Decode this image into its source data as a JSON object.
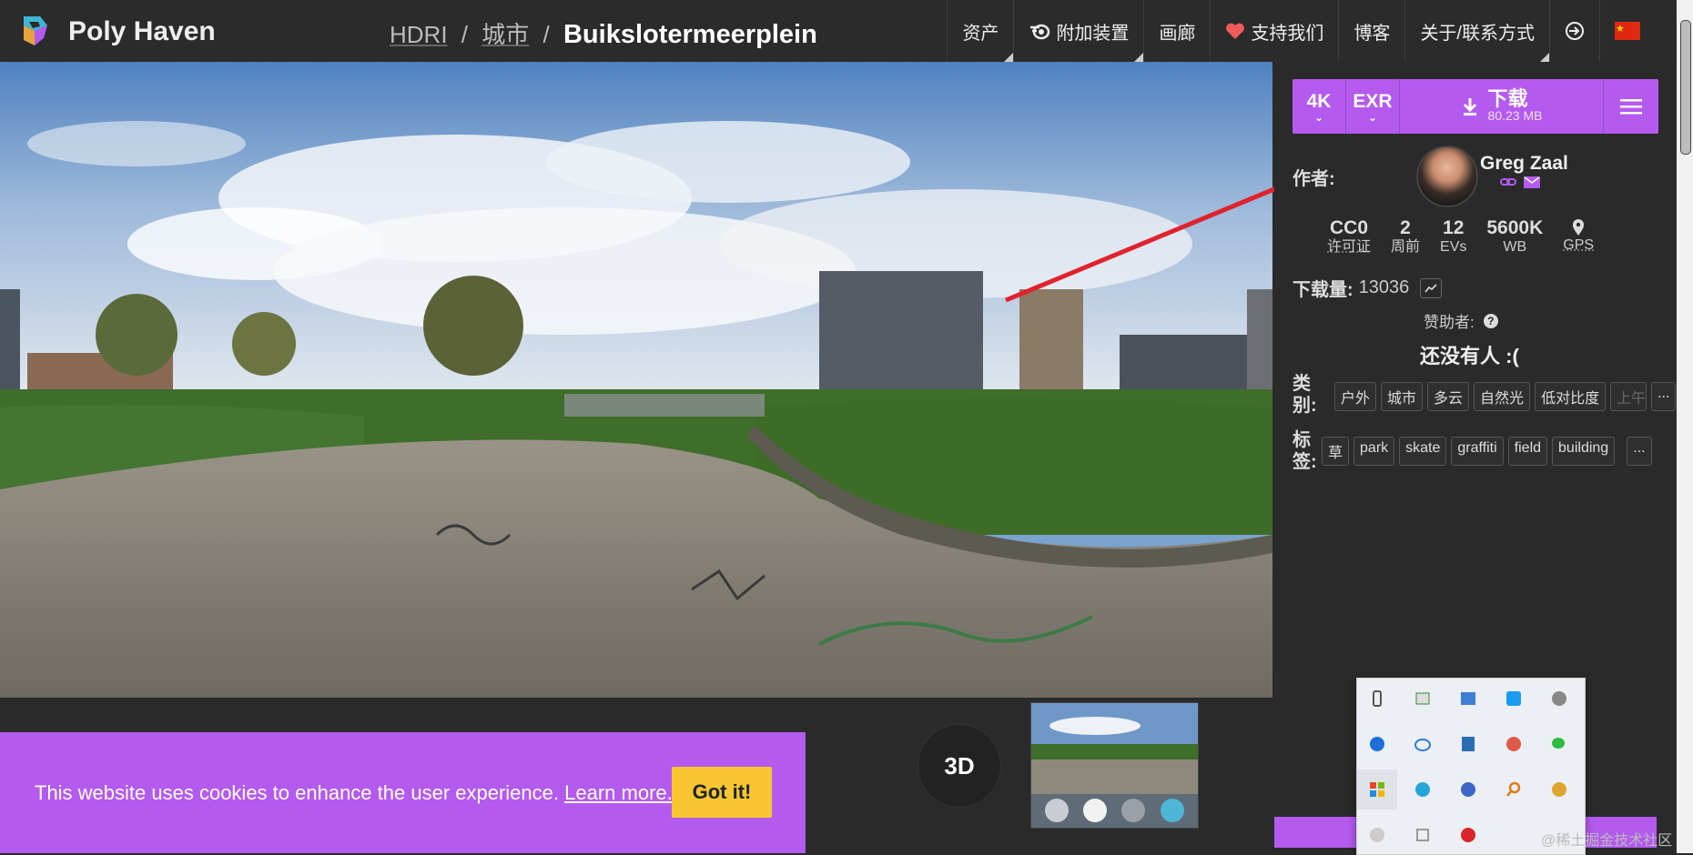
{
  "header": {
    "brand": "Poly Haven",
    "breadcrumb": {
      "root": "HDRI",
      "sep1": "/",
      "category": "城市",
      "sep2": "/",
      "current": "Buikslotermeerplein"
    },
    "nav": [
      {
        "label": "资产",
        "icon": ""
      },
      {
        "label": "附加装置",
        "icon": "blender-icon"
      },
      {
        "label": "画廊",
        "icon": ""
      },
      {
        "label": "支持我们",
        "icon": "heart-icon"
      },
      {
        "label": "博客",
        "icon": ""
      },
      {
        "label": "关于/联系方式",
        "icon": ""
      }
    ]
  },
  "download": {
    "resolution": "4K",
    "format": "EXR",
    "label": "下载",
    "size": "80.23 MB"
  },
  "author": {
    "label": "作者:",
    "name": "Greg Zaal"
  },
  "stats": [
    {
      "value": "CC0",
      "key": "许可证"
    },
    {
      "value": "2",
      "key": "周前"
    },
    {
      "value": "12",
      "key": "EVs"
    },
    {
      "value": "5600K",
      "key": "WB"
    },
    {
      "value": "",
      "key": "GPS"
    }
  ],
  "downloads": {
    "label": "下载量:",
    "count": "13036"
  },
  "sponsors": {
    "label": "赞助者:",
    "empty": "还没有人 :("
  },
  "categories": {
    "label": "类别:",
    "items": [
      "户外",
      "城市",
      "多云",
      "自然光",
      "低对比度",
      "上午"
    ],
    "more": "..."
  },
  "tags": {
    "label": "标签:",
    "items": [
      "草",
      "park",
      "skate",
      "graffiti",
      "field",
      "building"
    ],
    "more": "..."
  },
  "cookie": {
    "message": "This website uses cookies to enhance the user experience.",
    "link": "Learn more.",
    "button": "Got it!"
  },
  "viewer": {
    "button_3d": "3D"
  },
  "watermark": "@稀土掘金技术社区",
  "colors": {
    "accent": "#b45aef",
    "cookie_button": "#f7c631",
    "background": "#2a2a2a"
  }
}
